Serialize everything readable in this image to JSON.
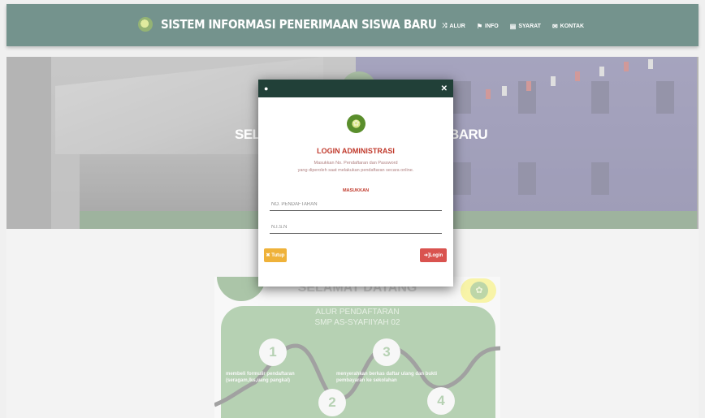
{
  "navbar": {
    "title": "SISTEM INFORMASI PENERIMAAN SISWA BARU",
    "links": [
      {
        "icon": "⤨",
        "label": "ALUR"
      },
      {
        "icon": "⚑",
        "label": "INFO"
      },
      {
        "icon": "▤",
        "label": "SYARAT"
      },
      {
        "icon": "✉",
        "label": "KONTAK"
      }
    ]
  },
  "hero": {
    "left_text": "SELA",
    "right_text": "BARU"
  },
  "welcome": {
    "title": "SELAMAT DATANG",
    "subtitle1": "ALUR PENDAFTARAN",
    "subtitle2": "SMP AS-SYAFIIYAH 02",
    "steps": [
      {
        "num": "1",
        "text": "membeli formulir pendaftaran (seragam,lks,uang pangkal)"
      },
      {
        "num": "2",
        "text": ""
      },
      {
        "num": "3",
        "text": "menyerahkan berkas daftar ulang dan bukti pembayaran ke sekolahan"
      },
      {
        "num": "4",
        "text": ""
      }
    ]
  },
  "modal": {
    "title": "LOGIN ADMINISTRASI",
    "desc1": "Masukkan No. Pendaftaran dan Password",
    "desc2": "yang diperoleh saat melakukan pendaftaran secara online.",
    "subtitle": "MASUKKAN",
    "field1_placeholder": "NO. PENDAFTARAN",
    "field2_placeholder": "N.I.S.N",
    "close_label": "✖ Tutup",
    "login_label": "➜]Login"
  },
  "colors": {
    "navbar": "#2a5a50",
    "modal_header": "#214038",
    "accent_red": "#c0392b",
    "close_btn": "#efb23a",
    "login_btn": "#d9534f",
    "green_panel": "#8fb98a"
  }
}
